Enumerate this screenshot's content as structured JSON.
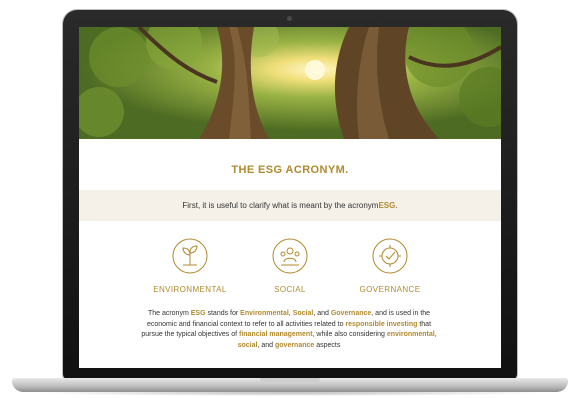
{
  "page": {
    "title": "THE ESG ACRONYM.",
    "intro": {
      "prefix": "First, it is useful to clarify what is meant by the acronym ",
      "highlight": "ESG",
      "suffix": "."
    },
    "pillars": [
      {
        "label": "ENVIRONMENTAL",
        "icon": "environmental-icon"
      },
      {
        "label": "SOCIAL",
        "icon": "social-icon"
      },
      {
        "label": "GOVERNANCE",
        "icon": "governance-icon"
      }
    ],
    "paragraph": {
      "t1": "The acronym ",
      "b1": "ESG",
      "t2": " stands for ",
      "b2": "Environmental",
      "t3": ", ",
      "b3": "Social",
      "t4": ", and ",
      "b4": "Governance",
      "t5": ", and is used in the economic and financial context to refer to all activities related to ",
      "b5": "responsible investing",
      "t6": " that pursue the typical objectives of ",
      "b6": "financial management",
      "t7": ", while also considering ",
      "b7": "environmental",
      "t8": ", ",
      "b8": "social",
      "t9": ", and ",
      "b9": "governance",
      "t10": " aspects"
    }
  },
  "colors": {
    "accent": "#b08a2e",
    "band": "#f5f1e8",
    "text": "#333333",
    "laptop_bezel": "#1a1a1a"
  }
}
